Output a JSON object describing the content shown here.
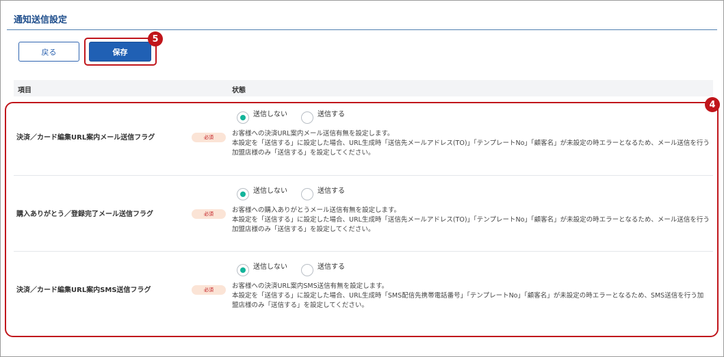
{
  "page": {
    "title": "通知送信設定"
  },
  "toolbar": {
    "back_label": "戻る",
    "save_label": "保存"
  },
  "annotations": {
    "save_marker": "5",
    "rows_marker": "4"
  },
  "table": {
    "header_item": "項目",
    "header_state": "状態",
    "required_label": "必須",
    "rows": [
      {
        "label": "決済／カード編集URL案内メール送信フラグ",
        "option_off": "送信しない",
        "option_on": "送信する",
        "selected": "送信しない",
        "desc_line1": "お客様への決済URL案内メール送信有無を設定します。",
        "desc_line2": "本設定を「送信する」に設定した場合、URL生成時「送信先メールアドレス(TO)」「テンプレートNo」「顧客名」が未設定の時エラーとなるため、メール送信を行う加盟店様のみ「送信する」を設定してください。"
      },
      {
        "label": "購入ありがとう／登録完了メール送信フラグ",
        "option_off": "送信しない",
        "option_on": "送信する",
        "selected": "送信しない",
        "desc_line1": "お客様への購入ありがとうメール送信有無を設定します。",
        "desc_line2": "本設定を「送信する」に設定した場合、URL生成時「送信先メールアドレス(TO)」「テンプレートNo」「顧客名」が未設定の時エラーとなるため、メール送信を行う加盟店様のみ「送信する」を設定してください。"
      },
      {
        "label": "決済／カード編集URL案内SMS送信フラグ",
        "option_off": "送信しない",
        "option_on": "送信する",
        "selected": "送信しない",
        "desc_line1": "お客様への決済URL案内SMS送信有無を設定します。",
        "desc_line2": "本設定を「送信する」に設定した場合、URL生成時「SMS配信先携帯電話番号」「テンプレートNo」「顧客名」が未設定の時エラーとなるため、SMS送信を行う加盟店様のみ「送信する」を設定してください。"
      }
    ]
  },
  "colors": {
    "accent": "#2060b4",
    "highlight": "#c0151b",
    "radio_checked": "#13b49a",
    "title": "#1f4e8c"
  }
}
